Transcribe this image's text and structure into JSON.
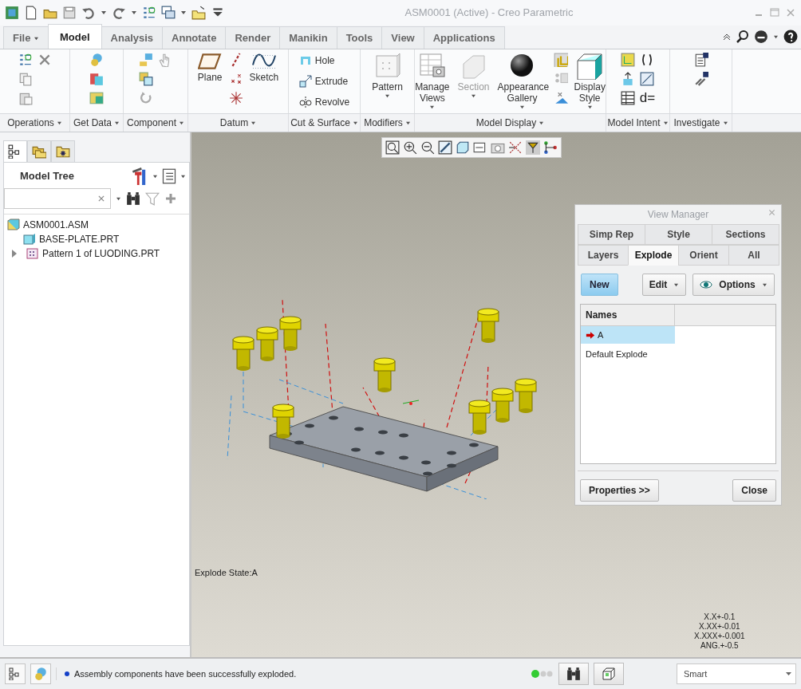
{
  "window": {
    "title": "ASM0001 (Active) - Creo Parametric"
  },
  "ribbon_tabs": [
    {
      "label": "File",
      "selected": false,
      "kind": "menu"
    },
    {
      "label": "Model",
      "selected": true,
      "kind": "tab"
    },
    {
      "label": "Analysis",
      "selected": false,
      "kind": "tab"
    },
    {
      "label": "Annotate",
      "selected": false,
      "kind": "tab"
    },
    {
      "label": "Render",
      "selected": false,
      "kind": "tab"
    },
    {
      "label": "Manikin",
      "selected": false,
      "kind": "tab"
    },
    {
      "label": "Tools",
      "selected": false,
      "kind": "tab"
    },
    {
      "label": "View",
      "selected": false,
      "kind": "tab"
    },
    {
      "label": "Applications",
      "selected": false,
      "kind": "tab"
    }
  ],
  "ribbon_groups": [
    {
      "label": "Operations"
    },
    {
      "label": "Get Data"
    },
    {
      "label": "Component"
    },
    {
      "label": "Datum",
      "items": [
        {
          "kind": "large",
          "label": "Plane",
          "dropdown": false,
          "disabled": false
        },
        {
          "kind": "large",
          "label": "Sketch",
          "dropdown": false,
          "disabled": false
        }
      ]
    },
    {
      "label": "Cut & Surface",
      "items": [
        {
          "kind": "small",
          "label": "Hole",
          "dropdown": false,
          "disabled": false
        },
        {
          "kind": "small",
          "label": "Extrude",
          "dropdown": false,
          "disabled": false
        },
        {
          "kind": "small",
          "label": "Revolve",
          "dropdown": false,
          "disabled": false
        }
      ]
    },
    {
      "label": "Modifiers",
      "items": [
        {
          "kind": "large",
          "label": "Pattern",
          "dropdown": true,
          "disabled": false
        }
      ]
    },
    {
      "label": "Model Display",
      "items": [
        {
          "kind": "large",
          "label": "Manage Views",
          "dropdown": true,
          "disabled": false
        },
        {
          "kind": "large",
          "label": "Section",
          "dropdown": true,
          "disabled": true
        },
        {
          "kind": "large",
          "label": "Appearance Gallery",
          "dropdown": true,
          "disabled": false
        },
        {
          "kind": "large",
          "label": "Display Style",
          "dropdown": true,
          "disabled": false
        }
      ]
    },
    {
      "label": "Model Intent",
      "items": [
        {
          "kind": "glyph",
          "label": "d="
        }
      ]
    },
    {
      "label": "Investigate"
    }
  ],
  "model_tree": {
    "title": "Model Tree",
    "items": [
      {
        "label": "ASM0001.ASM",
        "kind": "assembly",
        "children": [
          {
            "label": "BASE-PLATE.PRT",
            "kind": "part"
          },
          {
            "label": "Pattern 1 of LUODING.PRT",
            "kind": "pattern",
            "expanded": false
          }
        ]
      }
    ]
  },
  "viewport": {
    "explode_state": "Explode State:A",
    "tolerances": [
      "X.X+-0.1",
      "X.XX+-0.01",
      "X.XXX+-0.001",
      "ANG.+-0.5"
    ]
  },
  "view_manager": {
    "title": "View Manager",
    "tab_rows": [
      [
        {
          "label": "Simp Rep",
          "selected": false
        },
        {
          "label": "Style",
          "selected": false
        },
        {
          "label": "Sections",
          "selected": false
        }
      ],
      [
        {
          "label": "Layers",
          "selected": false
        },
        {
          "label": "Explode",
          "selected": true
        },
        {
          "label": "Orient",
          "selected": false
        },
        {
          "label": "All",
          "selected": false
        }
      ]
    ],
    "buttons": [
      {
        "label": "New",
        "kind": "primary"
      },
      {
        "label": "Edit",
        "kind": "dropdown"
      },
      {
        "label": "Options",
        "kind": "options"
      }
    ],
    "list_header": "Names",
    "rows": [
      {
        "label": "A",
        "selected": true,
        "active": true
      },
      {
        "label": "Default Explode",
        "selected": false,
        "active": false
      }
    ],
    "footer_buttons": [
      "Properties >>",
      "Close"
    ]
  },
  "status_bar": {
    "message": "Assembly components have been successfully exploded.",
    "filter": "Smart"
  }
}
